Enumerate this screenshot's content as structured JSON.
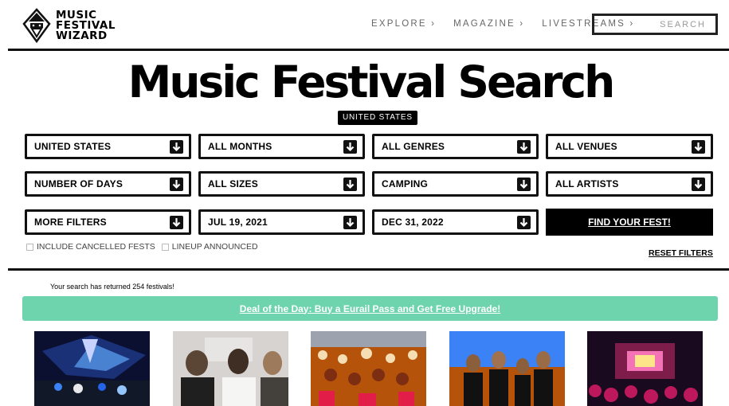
{
  "brand": {
    "line1": "MUSIC",
    "line2": "FESTIVAL",
    "line3": "WIZARD"
  },
  "nav": {
    "explore": "EXPLORE ›",
    "magazine": "MAGAZINE ›",
    "livestreams": "LIVESTREAMS ›"
  },
  "search": {
    "placeholder": "SEARCH"
  },
  "page": {
    "title": "Music Festival Search",
    "country_badge": "UNITED STATES"
  },
  "filters": {
    "country": "UNITED STATES",
    "months": "ALL MONTHS",
    "genres": "ALL GENRES",
    "venues": "ALL VENUES",
    "days": "NUMBER OF DAYS",
    "sizes": "ALL SIZES",
    "camping": "CAMPING",
    "artists": "ALL ARTISTS",
    "more": "MORE FILTERS",
    "start_date": "JUL 19, 2021",
    "end_date": "DEC 31, 2022"
  },
  "find_button": "FIND YOUR FEST!",
  "checkboxes": {
    "cancelled": "INCLUDE CANCELLED FESTS",
    "lineup": "LINEUP ANNOUNCED"
  },
  "reset_label": "RESET FILTERS",
  "results_text": "Your search has returned 254 festivals!",
  "deal_text": "Deal of the Day: Buy a Eurail Pass and Get Free Upgrade!",
  "colors": {
    "deal_banner": "#6dd4ad",
    "primary": "#000000"
  },
  "icons": {
    "dropdown": "chevron-down-icon",
    "logo": "wizard-logo-icon"
  }
}
